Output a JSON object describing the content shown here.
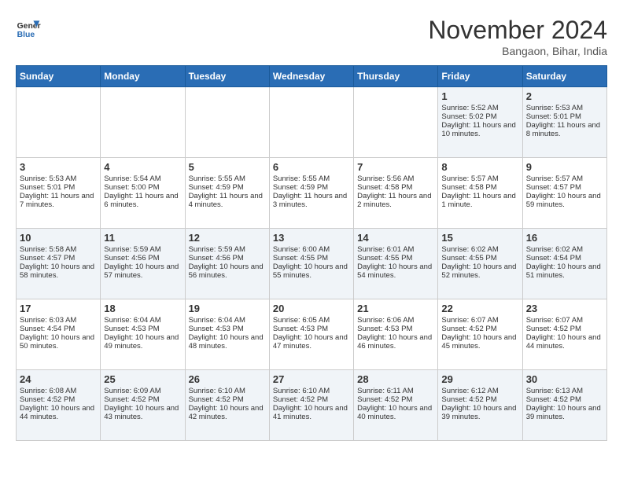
{
  "header": {
    "logo_line1": "General",
    "logo_line2": "Blue",
    "month_title": "November 2024",
    "location": "Bangaon, Bihar, India"
  },
  "weekdays": [
    "Sunday",
    "Monday",
    "Tuesday",
    "Wednesday",
    "Thursday",
    "Friday",
    "Saturday"
  ],
  "weeks": [
    [
      {
        "day": "",
        "content": ""
      },
      {
        "day": "",
        "content": ""
      },
      {
        "day": "",
        "content": ""
      },
      {
        "day": "",
        "content": ""
      },
      {
        "day": "",
        "content": ""
      },
      {
        "day": "1",
        "content": "Sunrise: 5:52 AM\nSunset: 5:02 PM\nDaylight: 11 hours and 10 minutes."
      },
      {
        "day": "2",
        "content": "Sunrise: 5:53 AM\nSunset: 5:01 PM\nDaylight: 11 hours and 8 minutes."
      }
    ],
    [
      {
        "day": "3",
        "content": "Sunrise: 5:53 AM\nSunset: 5:01 PM\nDaylight: 11 hours and 7 minutes."
      },
      {
        "day": "4",
        "content": "Sunrise: 5:54 AM\nSunset: 5:00 PM\nDaylight: 11 hours and 6 minutes."
      },
      {
        "day": "5",
        "content": "Sunrise: 5:55 AM\nSunset: 4:59 PM\nDaylight: 11 hours and 4 minutes."
      },
      {
        "day": "6",
        "content": "Sunrise: 5:55 AM\nSunset: 4:59 PM\nDaylight: 11 hours and 3 minutes."
      },
      {
        "day": "7",
        "content": "Sunrise: 5:56 AM\nSunset: 4:58 PM\nDaylight: 11 hours and 2 minutes."
      },
      {
        "day": "8",
        "content": "Sunrise: 5:57 AM\nSunset: 4:58 PM\nDaylight: 11 hours and 1 minute."
      },
      {
        "day": "9",
        "content": "Sunrise: 5:57 AM\nSunset: 4:57 PM\nDaylight: 10 hours and 59 minutes."
      }
    ],
    [
      {
        "day": "10",
        "content": "Sunrise: 5:58 AM\nSunset: 4:57 PM\nDaylight: 10 hours and 58 minutes."
      },
      {
        "day": "11",
        "content": "Sunrise: 5:59 AM\nSunset: 4:56 PM\nDaylight: 10 hours and 57 minutes."
      },
      {
        "day": "12",
        "content": "Sunrise: 5:59 AM\nSunset: 4:56 PM\nDaylight: 10 hours and 56 minutes."
      },
      {
        "day": "13",
        "content": "Sunrise: 6:00 AM\nSunset: 4:55 PM\nDaylight: 10 hours and 55 minutes."
      },
      {
        "day": "14",
        "content": "Sunrise: 6:01 AM\nSunset: 4:55 PM\nDaylight: 10 hours and 54 minutes."
      },
      {
        "day": "15",
        "content": "Sunrise: 6:02 AM\nSunset: 4:55 PM\nDaylight: 10 hours and 52 minutes."
      },
      {
        "day": "16",
        "content": "Sunrise: 6:02 AM\nSunset: 4:54 PM\nDaylight: 10 hours and 51 minutes."
      }
    ],
    [
      {
        "day": "17",
        "content": "Sunrise: 6:03 AM\nSunset: 4:54 PM\nDaylight: 10 hours and 50 minutes."
      },
      {
        "day": "18",
        "content": "Sunrise: 6:04 AM\nSunset: 4:53 PM\nDaylight: 10 hours and 49 minutes."
      },
      {
        "day": "19",
        "content": "Sunrise: 6:04 AM\nSunset: 4:53 PM\nDaylight: 10 hours and 48 minutes."
      },
      {
        "day": "20",
        "content": "Sunrise: 6:05 AM\nSunset: 4:53 PM\nDaylight: 10 hours and 47 minutes."
      },
      {
        "day": "21",
        "content": "Sunrise: 6:06 AM\nSunset: 4:53 PM\nDaylight: 10 hours and 46 minutes."
      },
      {
        "day": "22",
        "content": "Sunrise: 6:07 AM\nSunset: 4:52 PM\nDaylight: 10 hours and 45 minutes."
      },
      {
        "day": "23",
        "content": "Sunrise: 6:07 AM\nSunset: 4:52 PM\nDaylight: 10 hours and 44 minutes."
      }
    ],
    [
      {
        "day": "24",
        "content": "Sunrise: 6:08 AM\nSunset: 4:52 PM\nDaylight: 10 hours and 44 minutes."
      },
      {
        "day": "25",
        "content": "Sunrise: 6:09 AM\nSunset: 4:52 PM\nDaylight: 10 hours and 43 minutes."
      },
      {
        "day": "26",
        "content": "Sunrise: 6:10 AM\nSunset: 4:52 PM\nDaylight: 10 hours and 42 minutes."
      },
      {
        "day": "27",
        "content": "Sunrise: 6:10 AM\nSunset: 4:52 PM\nDaylight: 10 hours and 41 minutes."
      },
      {
        "day": "28",
        "content": "Sunrise: 6:11 AM\nSunset: 4:52 PM\nDaylight: 10 hours and 40 minutes."
      },
      {
        "day": "29",
        "content": "Sunrise: 6:12 AM\nSunset: 4:52 PM\nDaylight: 10 hours and 39 minutes."
      },
      {
        "day": "30",
        "content": "Sunrise: 6:13 AM\nSunset: 4:52 PM\nDaylight: 10 hours and 39 minutes."
      }
    ]
  ]
}
